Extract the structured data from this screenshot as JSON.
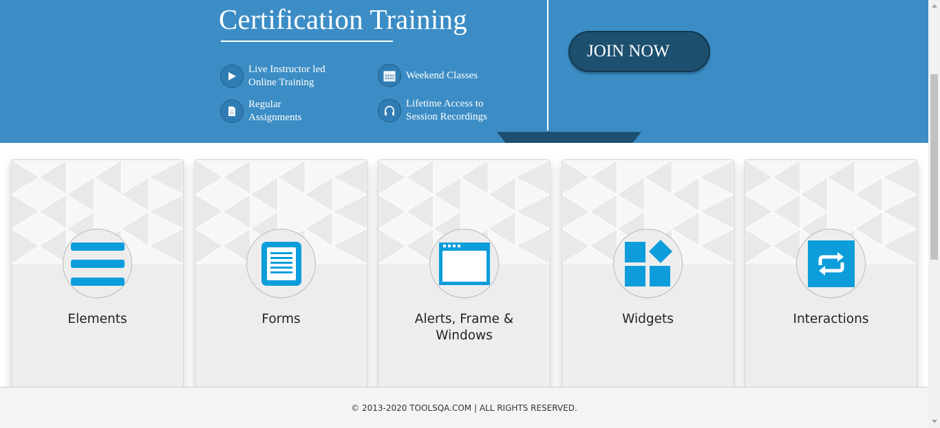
{
  "banner": {
    "title": "Certification Training",
    "features": [
      {
        "icon": "play-icon",
        "text": "Live Instructor led\nOnline Training"
      },
      {
        "icon": "calendar-icon",
        "text": "Weekend Classes"
      },
      {
        "icon": "document-icon",
        "text": "Regular\nAssignments"
      },
      {
        "icon": "headphones-icon",
        "text": "Lifetime Access to\nSession Recordings"
      }
    ],
    "join_label": "JOIN NOW"
  },
  "cards": [
    {
      "title": "Elements",
      "icon": "list-icon"
    },
    {
      "title": "Forms",
      "icon": "form-icon"
    },
    {
      "title": "Alerts, Frame & Windows",
      "icon": "window-icon"
    },
    {
      "title": "Widgets",
      "icon": "widgets-icon"
    },
    {
      "title": "Interactions",
      "icon": "interactions-icon"
    }
  ],
  "footer": {
    "text": "© 2013-2020 TOOLSQA.COM | ALL RIGHTS RESERVED."
  },
  "colors": {
    "banner": "#3c8dc5",
    "join_button": "#1d4f6f",
    "icon_accent": "#0d9ddb",
    "card_background": "#ededed"
  }
}
